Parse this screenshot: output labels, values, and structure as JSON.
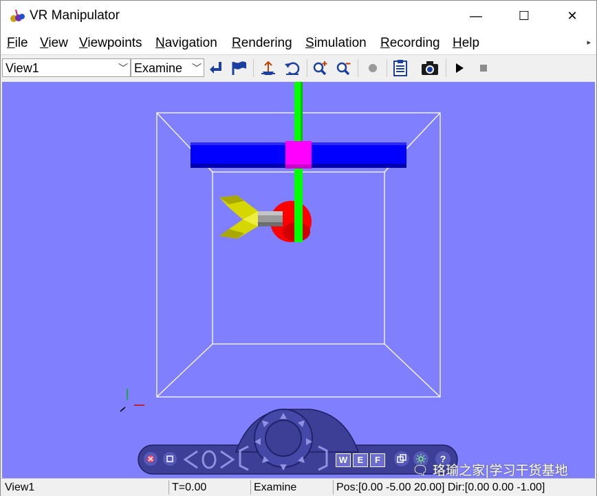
{
  "window": {
    "title": "VR Manipulator",
    "controls": {
      "minimize": "—",
      "maximize": "☐",
      "close": "✕"
    }
  },
  "menubar": {
    "items": [
      {
        "label": "File"
      },
      {
        "label": "View"
      },
      {
        "label": "Viewpoints"
      },
      {
        "label": "Navigation"
      },
      {
        "label": "Rendering"
      },
      {
        "label": "Simulation"
      },
      {
        "label": "Recording"
      },
      {
        "label": "Help"
      }
    ],
    "overflow": "▸"
  },
  "toolbar": {
    "viewpoint_select": "View1",
    "navigation_select": "Examine",
    "icons": [
      "return-icon",
      "flag-icon",
      "straighten-icon",
      "undo-move-icon",
      "zoom-in-icon",
      "zoom-out-icon",
      "record-icon",
      "clipboard-icon",
      "camera-icon",
      "play-icon",
      "stop-icon"
    ]
  },
  "navpanel": {
    "labels": {
      "w": "W",
      "e": "E",
      "f": "F",
      "help": "?"
    }
  },
  "statusbar": {
    "viewpoint": "View1",
    "time": "T=0.00",
    "nav_mode": "Examine",
    "position": "Pos:[0.00 -5.00 20.00] Dir:[0.00 0.00 -1.00]"
  },
  "watermark": "🗨 珞瑜之家|学习干货基地",
  "colors": {
    "viewport_bg": "#8080ff",
    "crossbar": "#0000ff",
    "slider_block": "#ff00ff",
    "vertical_rod": "#00ff00",
    "joint": "#ff0000",
    "gripper": "#c8c800",
    "arm": "#8c8c8c",
    "wireframe": "#ffffff",
    "navpanel": "#3d3f96"
  }
}
